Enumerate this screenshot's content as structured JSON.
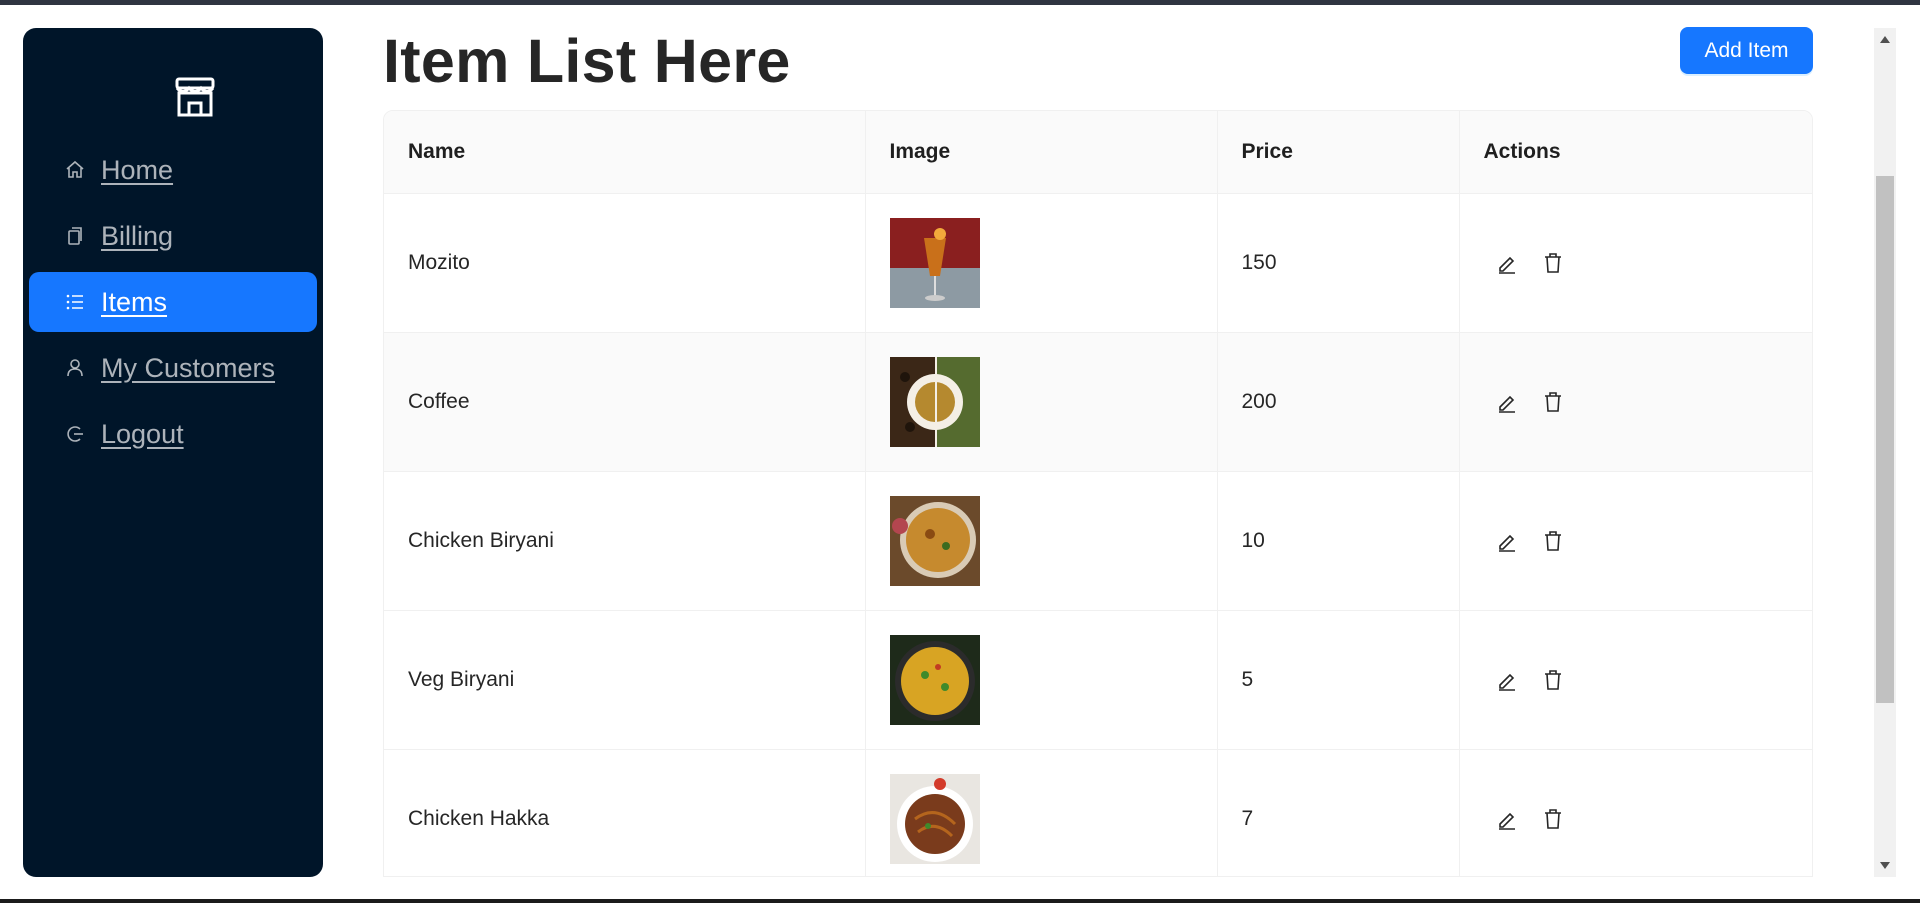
{
  "sidebar": {
    "logo_icon": "storefront-icon",
    "items": [
      {
        "label": "Home",
        "icon": "home-icon",
        "active": false
      },
      {
        "label": "Billing",
        "icon": "copy-icon",
        "active": false
      },
      {
        "label": "Items",
        "icon": "unordered-list-icon",
        "active": true
      },
      {
        "label": "My Customers",
        "icon": "user-icon",
        "active": false
      },
      {
        "label": "Logout",
        "icon": "logout-icon",
        "active": false
      }
    ]
  },
  "header": {
    "title": "Item List Here",
    "add_button_label": "Add Item"
  },
  "table": {
    "columns": [
      "Name",
      "Image",
      "Price",
      "Actions"
    ],
    "rows": [
      {
        "name": "Mozito",
        "image": "mojito-drink-photo",
        "price": "150"
      },
      {
        "name": "Coffee",
        "image": "coffee-cup-photo",
        "price": "200"
      },
      {
        "name": "Chicken Biryani",
        "image": "chicken-biryani-photo",
        "price": "10"
      },
      {
        "name": "Veg Biryani",
        "image": "veg-biryani-photo",
        "price": "5"
      },
      {
        "name": "Chicken Hakka",
        "image": "chicken-hakka-photo",
        "price": "7"
      }
    ],
    "action_icons": [
      "edit-icon",
      "delete-icon"
    ]
  },
  "colors": {
    "sidebar_bg": "#001529",
    "accent": "#1677ff",
    "header_bg": "#fafafa"
  }
}
